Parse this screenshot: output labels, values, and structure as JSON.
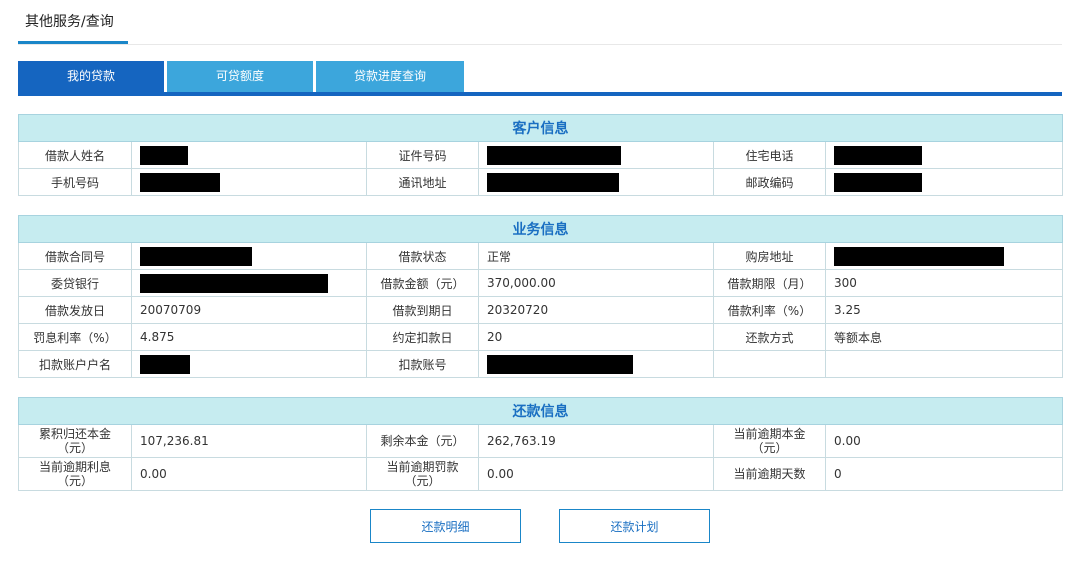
{
  "header": {
    "title": "其他服务/查询"
  },
  "tabs": [
    {
      "label": "我的贷款"
    },
    {
      "label": "可贷额度"
    },
    {
      "label": "贷款进度查询"
    }
  ],
  "customer": {
    "title": "客户信息",
    "borrower_name_label": "借款人姓名",
    "id_number_label": "证件号码",
    "home_phone_label": "住宅电话",
    "mobile_label": "手机号码",
    "address_label": "通讯地址",
    "postcode_label": "邮政编码"
  },
  "business": {
    "title": "业务信息",
    "contract_no_label": "借款合同号",
    "status_label": "借款状态",
    "status_value": "正常",
    "house_address_label": "购房地址",
    "bank_label": "委贷银行",
    "amount_label": "借款金额（元）",
    "amount_value": "370,000.00",
    "term_label": "借款期限（月）",
    "term_value": "300",
    "issue_date_label": "借款发放日",
    "issue_date_value": "20070709",
    "due_date_label": "借款到期日",
    "due_date_value": "20320720",
    "rate_label": "借款利率（%）",
    "rate_value": "3.25",
    "penalty_rate_label": "罚息利率（%）",
    "penalty_rate_value": "4.875",
    "deduct_day_label": "约定扣款日",
    "deduct_day_value": "20",
    "repay_method_label": "还款方式",
    "repay_method_value": "等额本息",
    "account_name_label": "扣款账户户名",
    "account_no_label": "扣款账号"
  },
  "repayment": {
    "title": "还款信息",
    "repaid_principal_label_1": "累积归还本金",
    "repaid_principal_label_2": "（元）",
    "repaid_principal_value": "107,236.81",
    "remaining_label": "剩余本金（元）",
    "remaining_value": "262,763.19",
    "overdue_principal_label_1": "当前逾期本金",
    "overdue_principal_label_2": "（元）",
    "overdue_principal_value": "0.00",
    "overdue_interest_label_1": "当前逾期利息",
    "overdue_interest_label_2": "（元）",
    "overdue_interest_value": "0.00",
    "overdue_penalty_label_1": "当前逾期罚款",
    "overdue_penalty_label_2": "（元）",
    "overdue_penalty_value": "0.00",
    "overdue_days_label": "当前逾期天数",
    "overdue_days_value": "0"
  },
  "buttons": {
    "detail": "还款明细",
    "plan": "还款计划"
  }
}
